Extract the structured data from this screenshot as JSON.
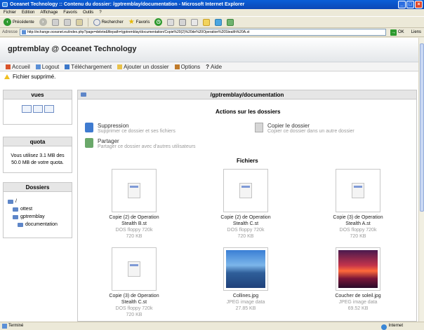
{
  "window": {
    "title": "Oceanet Technology :: Contenu du dossier: /gptremblay/documentation - Microsoft Internet Explorer"
  },
  "menubar": [
    "Fichier",
    "Edition",
    "Affichage",
    "Favoris",
    "Outils",
    "?"
  ],
  "toolbar": {
    "back_label": "Précédente",
    "search_label": "Rechercher",
    "favorites_label": "Favoris"
  },
  "address": {
    "label": "Adresse",
    "url": "http://echange.oceanet.eu/index.php?page=delete&filepath=/gptremblay/documentation/Copie%20(2)%20de%20Operation%20Stealth%20A.st",
    "go_label": "OK",
    "links_label": "Liens"
  },
  "site": {
    "title": "gptremblay @ Oceanet Technology",
    "nav": [
      "Accueil",
      "Logout",
      "Téléchargement",
      "Ajouter un dossier",
      "Options",
      "Aide"
    ],
    "message": "Fichier supprimé."
  },
  "sidebar": {
    "views_title": "vues",
    "quota_title": "quota",
    "quota_text": "Vous utilisez 3.1 MB des 50.0 MB de votre quota.",
    "folders_title": "Dossiers",
    "tree": [
      "/",
      "ottest",
      "gptremblay",
      "documentation"
    ]
  },
  "main": {
    "path": "/gptremblay/documentation",
    "actions_title": "Actions sur les dossiers",
    "actions": [
      {
        "title": "Suppression",
        "desc": "Supprimer ce dossier et ses fichiers"
      },
      {
        "title": "Copier le dossier",
        "desc": "Copier ce dossier dans un autre dossier"
      },
      {
        "title": "Partager",
        "desc": "Partager ce dossier avec d'autres utilisateurs"
      }
    ],
    "files_title": "Fichiers",
    "files": [
      {
        "name": "Copie (2) de Operation Stealth B.st",
        "type": "DOS floppy 720k",
        "size": "720 KB"
      },
      {
        "name": "Copie (2) de Operation Stealth C.st",
        "type": "DOS floppy 720k",
        "size": "720 KB"
      },
      {
        "name": "Copie (3) de Operation Stealth A.st",
        "type": "DOS floppy 720k",
        "size": "720 KB"
      },
      {
        "name": "Copie (3) de Operation Stealth C.st",
        "type": "DOS floppy 720k",
        "size": "720 KB"
      },
      {
        "name": "Collines.jpg",
        "type": "JPEG image data",
        "size": "27.85 KB"
      },
      {
        "name": "Coucher de soleil.jpg",
        "type": "JPEG image data",
        "size": "69.52 KB"
      }
    ]
  },
  "status": {
    "text": "Terminé",
    "zone": "Internet"
  }
}
